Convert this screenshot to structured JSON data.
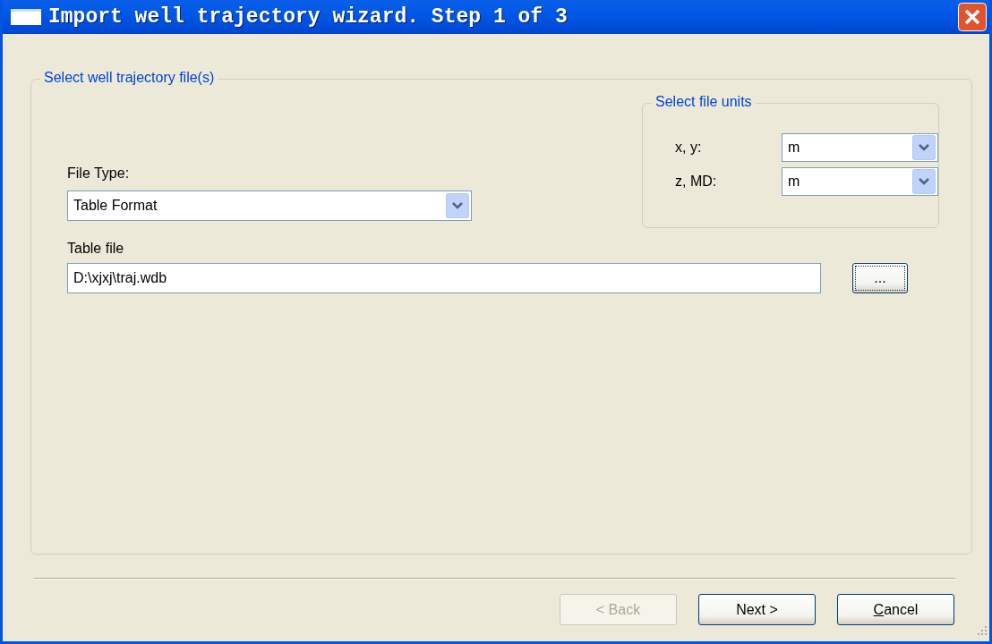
{
  "window": {
    "title": "Import well trajectory wizard. Step 1 of 3"
  },
  "file_group": {
    "title": "Select well trajectory file(s)",
    "file_type": {
      "label": "File Type:",
      "value": "Table Format"
    },
    "table_file": {
      "label": "Table file",
      "value": "D:\\xjxj\\traj.wdb"
    },
    "browse_button": {
      "label": "...",
      "focused": true
    }
  },
  "units_group": {
    "title": "Select file units",
    "rows": [
      {
        "label": "x, y:",
        "value": "m"
      },
      {
        "label": "z, MD:",
        "value": "m"
      }
    ]
  },
  "buttons": [
    {
      "label": "< Back",
      "disabled": true
    },
    {
      "label": "Next >",
      "disabled": false
    },
    {
      "label": "Cancel",
      "disabled": false,
      "underline_first": true
    }
  ]
}
